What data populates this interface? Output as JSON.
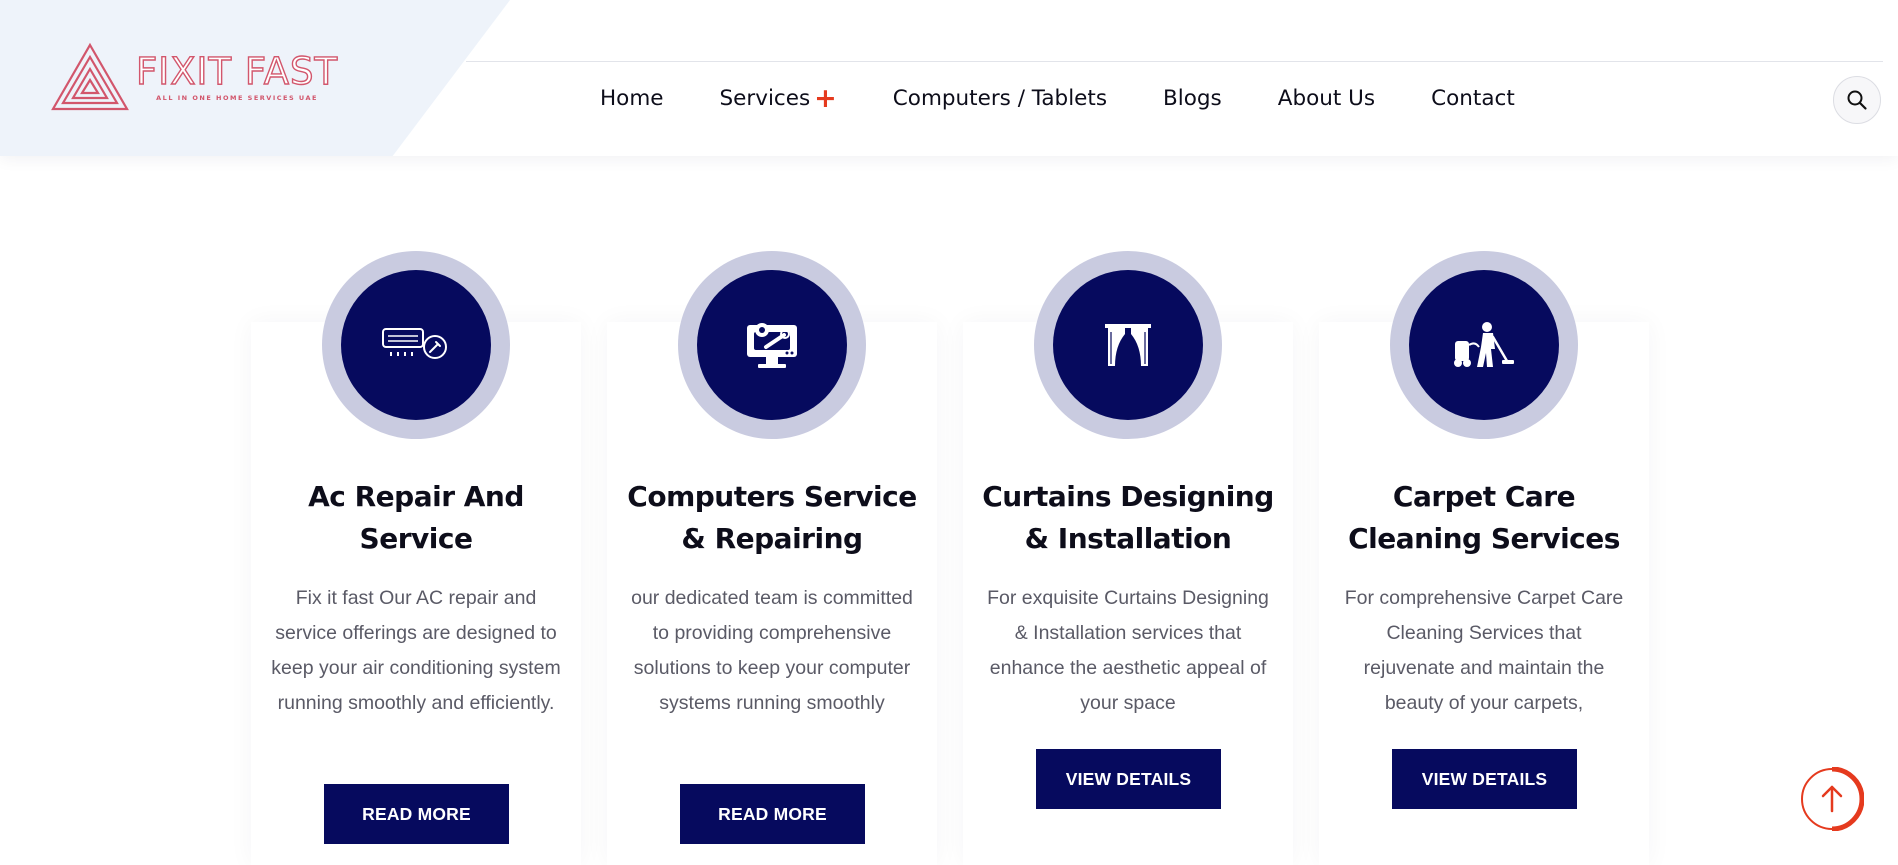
{
  "brand": {
    "name": "FIXIT FAST",
    "tagline": "ALL IN ONE HOME SERVICES UAE",
    "color": "#d2566c"
  },
  "nav": {
    "items": [
      {
        "label": "Home"
      },
      {
        "label": "Services"
      },
      {
        "label": "Computers / Tablets"
      },
      {
        "label": "Blogs"
      },
      {
        "label": "About Us"
      },
      {
        "label": "Contact"
      }
    ],
    "services_expand_icon": "plus-icon",
    "search_icon": "search-icon"
  },
  "services": [
    {
      "title_line1": "Ac Repair And",
      "title_line2": "Service",
      "description": "Fix it fast Our AC repair and service offerings are designed to keep your air conditioning system running smoothly and efficiently.",
      "button": "READ MORE",
      "icon": "air-conditioner-icon"
    },
    {
      "title_line1": "Computers Service",
      "title_line2": "& Repairing",
      "description": "our dedicated team is committed to providing comprehensive solutions to keep your computer systems running smoothly",
      "button": "READ MORE",
      "icon": "computer-repair-icon"
    },
    {
      "title_line1": "Curtains Designing",
      "title_line2": "& Installation",
      "description": "For exquisite Curtains Designing & Installation services that enhance the aesthetic appeal of your space",
      "button": "VIEW DETAILS",
      "icon": "curtains-icon"
    },
    {
      "title_line1": "Carpet Care",
      "title_line2": "Cleaning Services",
      "description": "For comprehensive Carpet Care Cleaning Services that rejuvenate and maintain the beauty of your carpets,",
      "button": "VIEW DETAILS",
      "icon": "carpet-cleaning-icon"
    }
  ],
  "colors": {
    "primary": "#060a5e",
    "accent": "#e53a1e",
    "icon_ring": "#c9cbe0",
    "text": "#0d0d1a",
    "muted_text": "#5a5a66"
  },
  "scroll_top_icon": "arrow-up-icon"
}
